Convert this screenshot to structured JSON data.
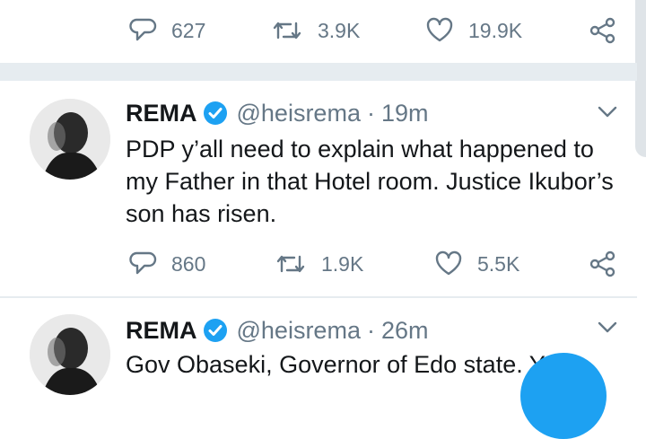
{
  "top_actions": {
    "replies": "627",
    "retweets": "3.9K",
    "likes": "19.9K"
  },
  "tweets": [
    {
      "name": "REMA",
      "handle": "@heisrema",
      "dot": "·",
      "time": "19m",
      "text": "PDP y’all need to explain what happened to my Father in that Hotel room. Justice Ikubor’s son has risen.",
      "replies": "860",
      "retweets": "1.9K",
      "likes": "5.5K"
    },
    {
      "name": "REMA",
      "handle": "@heisrema",
      "dot": "·",
      "time": "26m",
      "text_visible": "Gov Obaseki, Governor of Edo state. Y"
    }
  ],
  "colors": {
    "accent": "#1da1f2",
    "secondary_text": "#657786",
    "separator": "#e6ecf0"
  }
}
